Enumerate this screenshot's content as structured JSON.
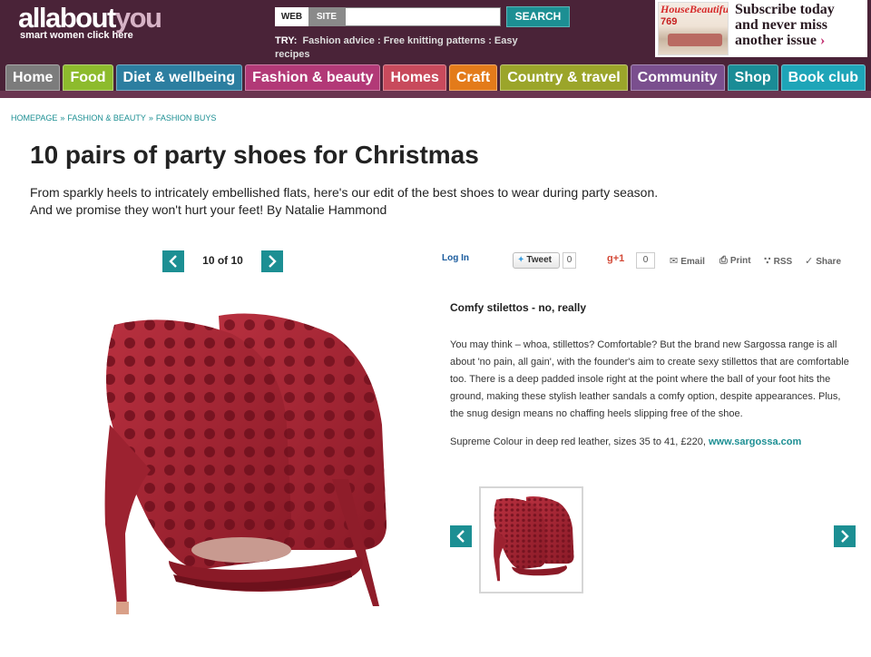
{
  "colors": {
    "header_bg": "#4a2338",
    "teal": "#1c8f93",
    "shoe_red": "#a52232"
  },
  "header": {
    "logo_part1": "allabout",
    "logo_part2": "you",
    "tagline": "smart women click here",
    "search": {
      "mode_web": "WEB",
      "mode_site": "SITE",
      "input_value": "",
      "button_label": "SEARCH"
    },
    "try_label": "TRY:",
    "try_links": "Fashion advice : Free knitting patterns : Easy recipes",
    "subscribe": {
      "magazine_title": "HouseBeautiful",
      "magazine_number": "769",
      "line1": "Subscribe today",
      "line2": "and never miss",
      "line3": "another issue",
      "arrow": "›"
    }
  },
  "nav": {
    "items": [
      {
        "label": "Home",
        "color": "#7c7c7c"
      },
      {
        "label": "Food",
        "color": "#8dbb2d"
      },
      {
        "label": "Diet & wellbeing",
        "color": "#2c7ea0"
      },
      {
        "label": "Fashion & beauty",
        "color": "#b23977"
      },
      {
        "label": "Homes",
        "color": "#c84a5c"
      },
      {
        "label": "Craft",
        "color": "#e37b1a"
      },
      {
        "label": "Country & travel",
        "color": "#9ba52a"
      },
      {
        "label": "Community",
        "color": "#7a4f8e"
      },
      {
        "label": "Shop",
        "color": "#1a8c96"
      },
      {
        "label": "Book club",
        "color": "#1ea5b8"
      }
    ]
  },
  "breadcrumb": {
    "items": [
      "HOMEPAGE",
      "FASHION & BEAUTY",
      "FASHION BUYS"
    ],
    "separator": "»"
  },
  "article": {
    "title": "10 pairs of party shoes for Christmas",
    "intro_line1": "From sparkly heels to intricately embellished flats, here's our edit of the best shoes to wear during party season.",
    "intro_line2": "And we promise they won't hurt your feet! By Natalie Hammond"
  },
  "gallery": {
    "counter": "10 of 10",
    "prev_icon": "chevron-left-icon",
    "next_icon": "chevron-right-icon"
  },
  "social": {
    "login": "Log In",
    "tweet": "Tweet",
    "tweet_count": "0",
    "gplus": "g+1",
    "gplus_count": "0",
    "email": "Email",
    "print": "Print",
    "rss": "RSS",
    "share": "Share"
  },
  "item": {
    "heading": "Comfy stilettos - no, really",
    "body": "You may think – whoa, stillettos? Comfortable? But the brand new Sargossa range is all about 'no pain, all gain', with the founder's aim to create sexy stillettos that are comfortable too. There is a deep padded insole right at the point where the ball of your foot hits the ground, making these stylish leather sandals a comfy option, despite appearances. Plus, the snug design means no chaffing heels slipping free of the shoe.",
    "credit_text": "Supreme Colour in deep red leather, sizes 35 to 41, £220, ",
    "credit_link": "www.sargossa.com"
  }
}
